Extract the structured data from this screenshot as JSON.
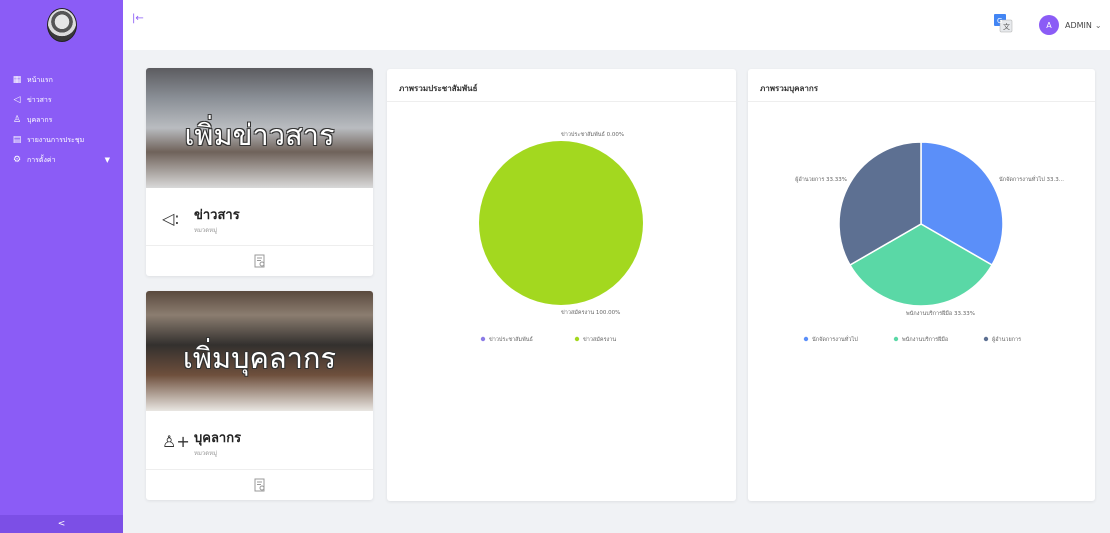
{
  "header": {
    "user_initial": "A",
    "user_name": "ADMIN",
    "translate_icon": "translate-icon"
  },
  "sidebar": {
    "items": [
      {
        "label": "หน้าแรก",
        "icon": "dashboard-icon"
      },
      {
        "label": "ข่าวสาร",
        "icon": "megaphone-icon"
      },
      {
        "label": "บุคลากร",
        "icon": "users-icon"
      },
      {
        "label": "รายงานการประชุม",
        "icon": "report-icon"
      },
      {
        "label": "การตั้งค่า",
        "icon": "gear-icon"
      }
    ],
    "collapse_label": "<"
  },
  "cards": [
    {
      "banner_text": "เพิ่มข่าวสาร",
      "title": "ข่าวสาร",
      "subtitle": "หมวดหมู่"
    },
    {
      "banner_text": "เพิ่มบุคลากร",
      "title": "บุคลากร",
      "subtitle": "หมวดหมู่"
    }
  ],
  "chart_data": [
    {
      "type": "pie",
      "title": "ภาพรวมประชาสัมพันธ์",
      "categories": [
        "ข่าวประชาสัมพันธ์",
        "ข่าวสมัครงาน"
      ],
      "values": [
        0,
        100
      ],
      "labels": [
        "ข่าวประชาสัมพันธ์ 0.00%",
        "ข่าวสมัครงาน 100.00%"
      ],
      "colors": [
        "#8b7be6",
        "#a3d81f"
      ],
      "legend": "bottom"
    },
    {
      "type": "pie",
      "title": "ภาพรวมบุคลากร",
      "categories": [
        "นักจัดการงานทั่วไป",
        "พนักงานบริการฝีมือ",
        "ผู้อำนวยการ"
      ],
      "values": [
        33.33,
        33.33,
        33.33
      ],
      "labels": [
        "นักจัดการงานทั่วไป 33.3...",
        "พนักงานบริการฝีมือ 33.33%",
        "ผู้อำนวยการ 33.33%"
      ],
      "colors": [
        "#5b8ff9",
        "#5ad8a6",
        "#5d7092"
      ],
      "legend": "bottom"
    }
  ]
}
